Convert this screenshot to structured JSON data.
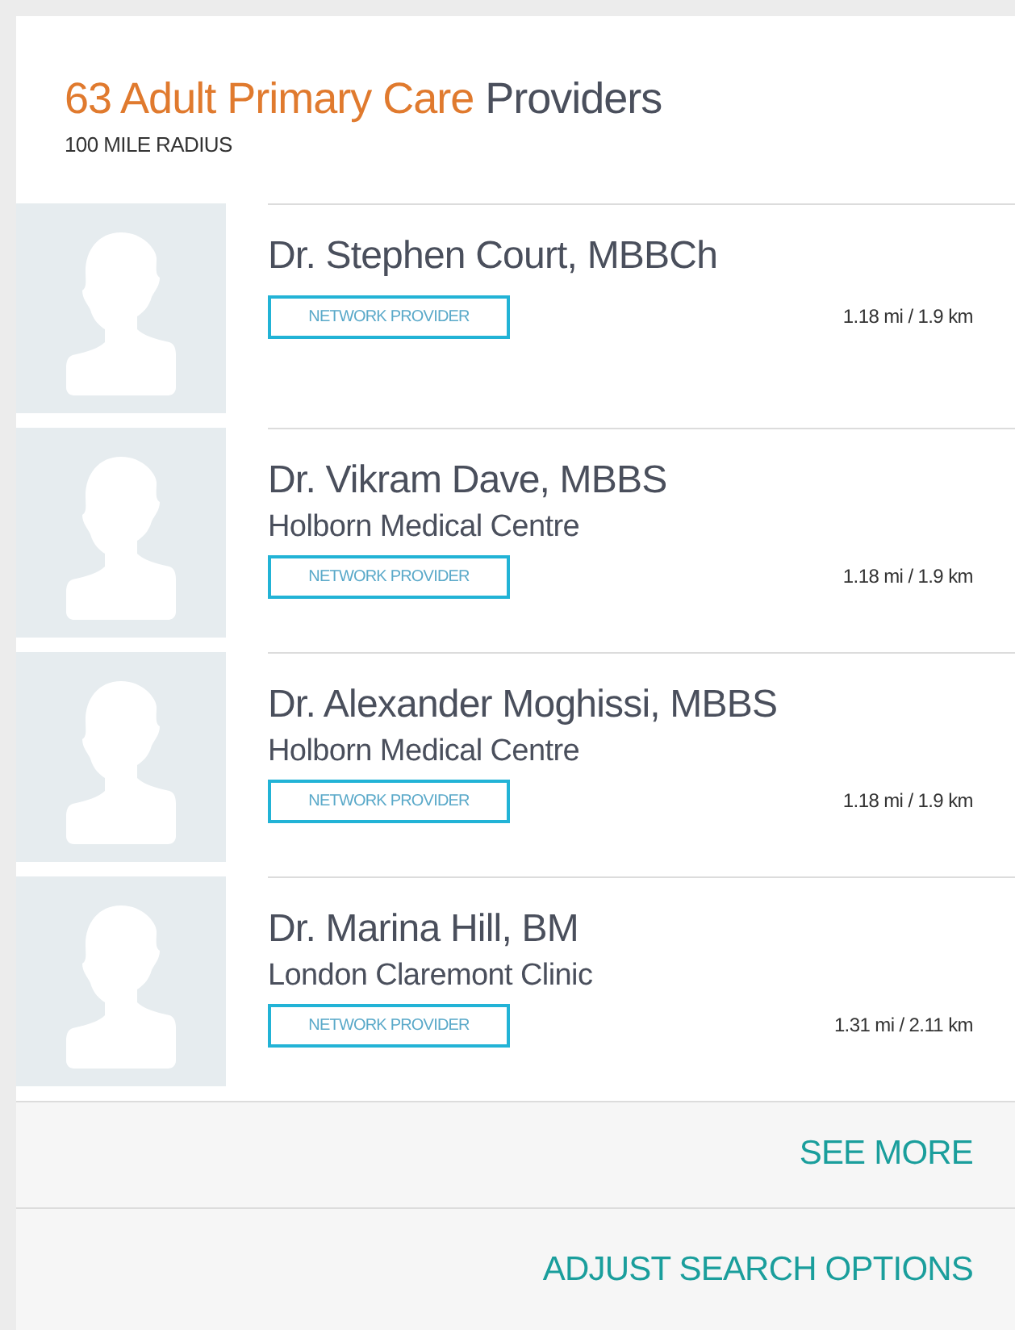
{
  "header": {
    "title_highlight": "63 Adult Primary Care",
    "title_rest": "Providers",
    "subtitle": "100 MILE RADIUS"
  },
  "providers": [
    {
      "name": "Dr. Stephen Court, MBBCh",
      "badge": "NETWORK PROVIDER",
      "distance": "1.18 mi / 1.9 km"
    },
    {
      "name": "Dr. Vikram Dave, MBBS",
      "practice": "Holborn Medical Centre",
      "badge": "NETWORK PROVIDER",
      "distance": "1.18 mi / 1.9 km"
    },
    {
      "name": "Dr. Alexander Moghissi, MBBS",
      "practice": "Holborn Medical Centre",
      "badge": "NETWORK PROVIDER",
      "distance": "1.18 mi / 1.9 km"
    },
    {
      "name": "Dr. Marina Hill, BM",
      "practice": "London Claremont Clinic",
      "badge": "NETWORK PROVIDER",
      "distance": "1.31 mi / 2.11 km"
    }
  ],
  "footer": {
    "see_more": "SEE MORE",
    "adjust": "ADJUST SEARCH OPTIONS"
  }
}
